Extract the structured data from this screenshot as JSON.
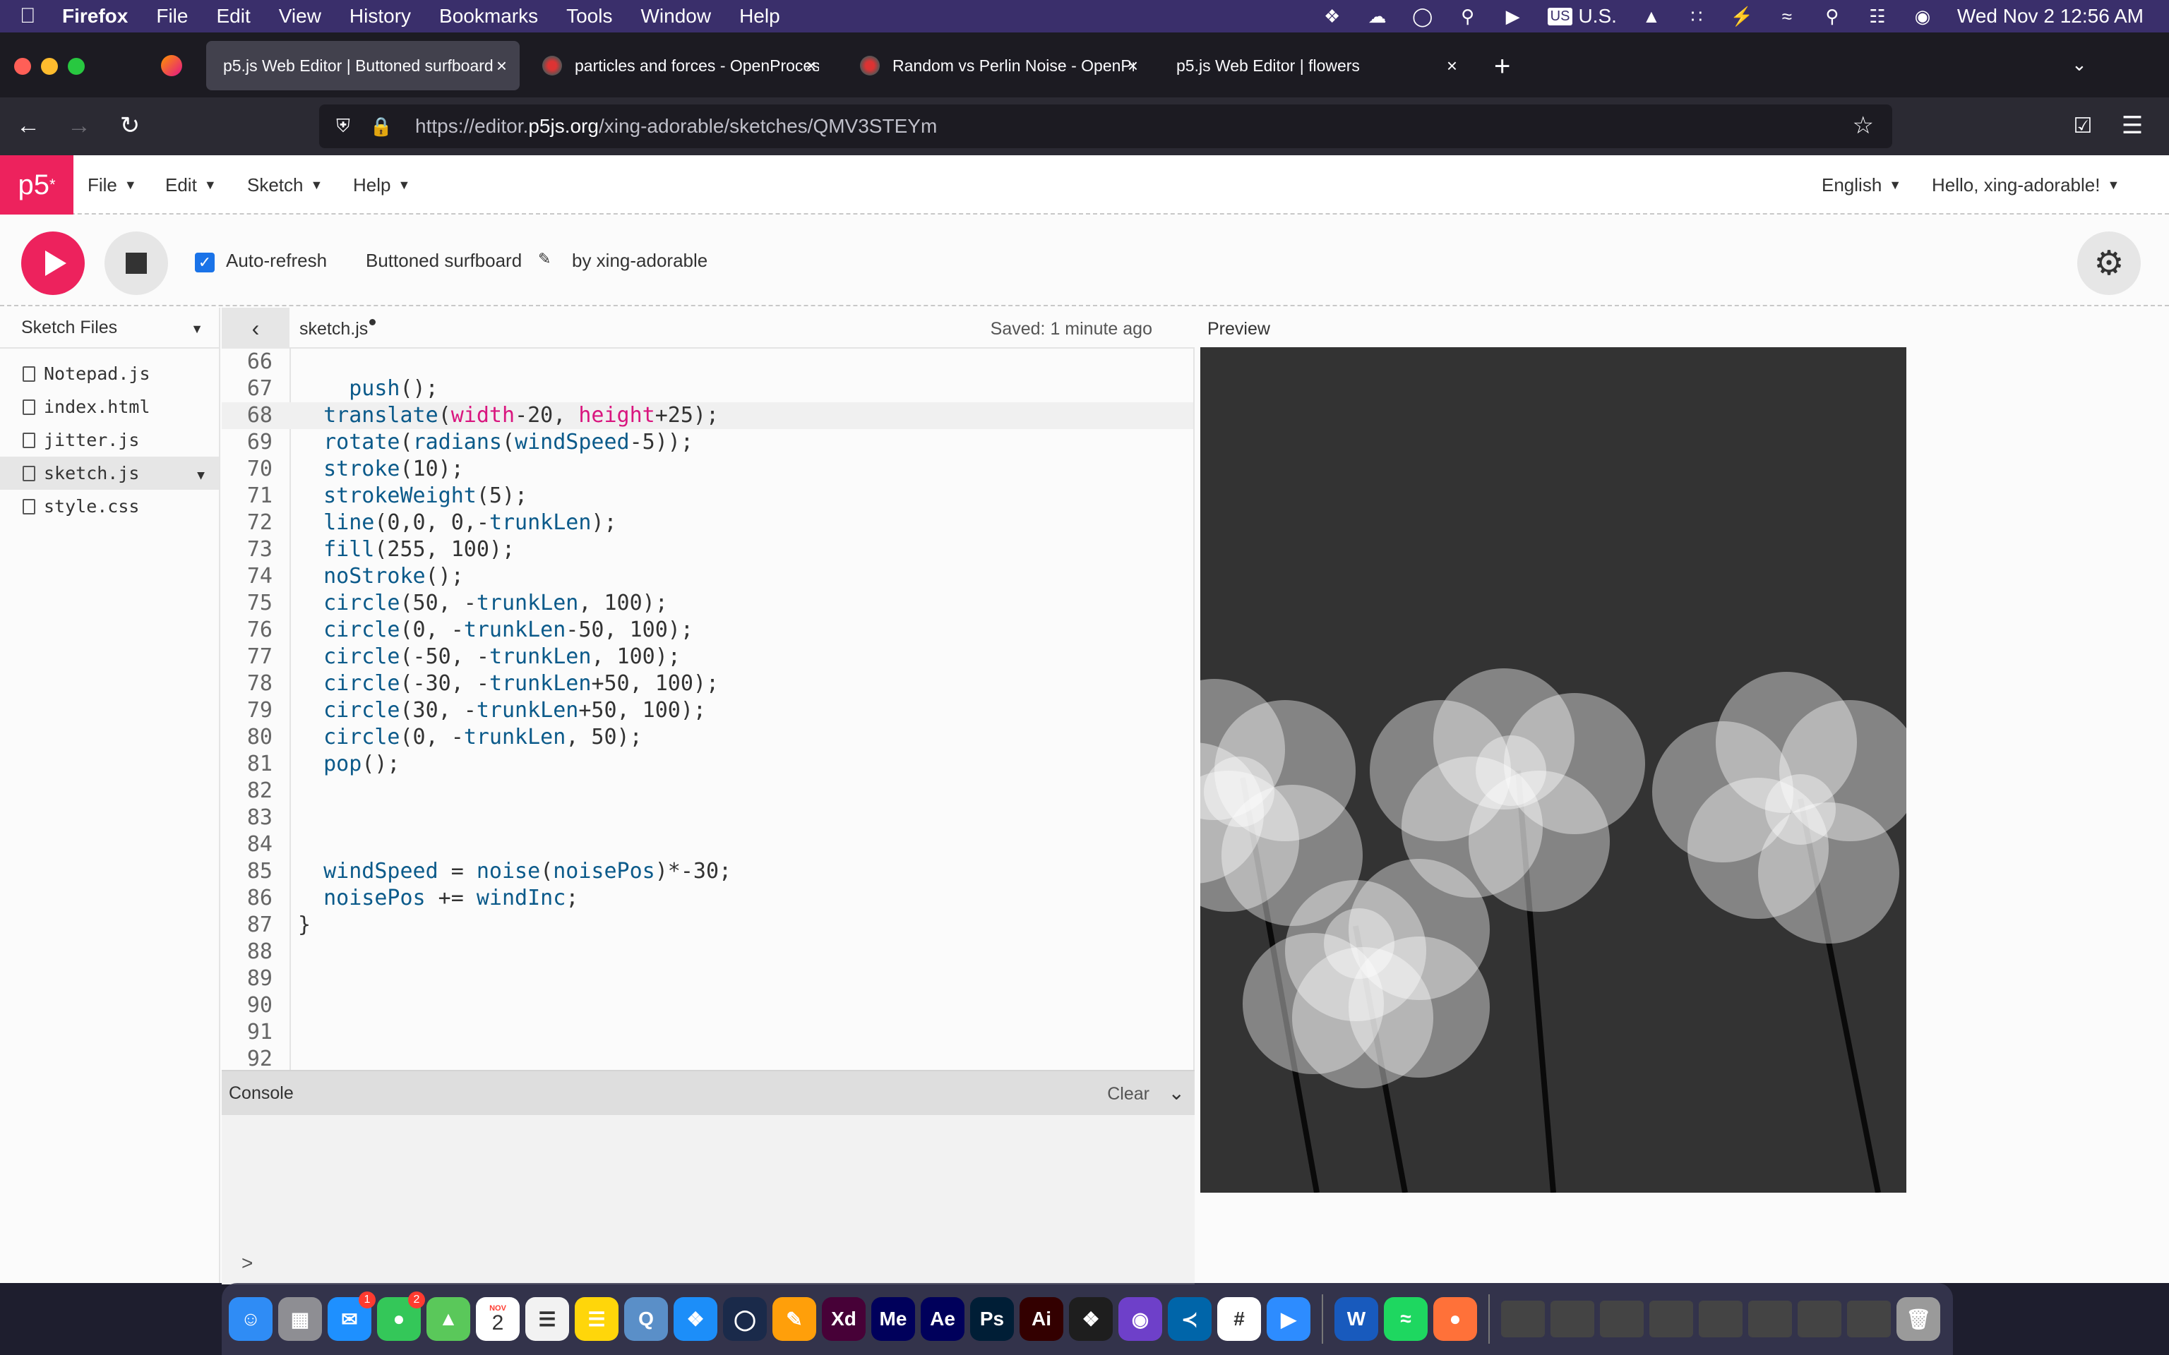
{
  "menubar": {
    "apple": "",
    "app": "Firefox",
    "items": [
      "File",
      "Edit",
      "View",
      "History",
      "Bookmarks",
      "Tools",
      "Window",
      "Help"
    ],
    "input_source": "U.S.",
    "clock": "Wed Nov 2  12:56 AM"
  },
  "tabs": [
    {
      "title": "p5.js Web Editor | Buttoned surfboard",
      "active": true
    },
    {
      "title": "particles and forces - OpenProcessing",
      "active": false
    },
    {
      "title": "Random vs Perlin Noise - OpenProcessing",
      "active": false
    },
    {
      "title": "p5.js Web Editor | flowers",
      "active": false
    }
  ],
  "urlbar": {
    "prefix": "https://editor.",
    "domain": "p5js.org",
    "path": "/xing-adorable/sketches/QMV3STEYm"
  },
  "p5": {
    "logo": "p5",
    "menu": [
      "File",
      "Edit",
      "Sketch",
      "Help"
    ],
    "language": "English",
    "user": "Hello, xing-adorable!",
    "auto_refresh": "Auto-refresh",
    "sketch_name": "Buttoned surfboard",
    "author": "by xing-adorable"
  },
  "sidebar": {
    "title": "Sketch Files",
    "files": [
      "Notepad.js",
      "index.html",
      "jitter.js",
      "sketch.js",
      "style.css"
    ],
    "selected": "sketch.js"
  },
  "editor": {
    "filename": "sketch.js",
    "saved": "Saved: 1 minute ago",
    "current_line": 68,
    "lines": [
      {
        "n": "66",
        "t": ""
      },
      {
        "n": "67",
        "t": "    push();"
      },
      {
        "n": "68",
        "t": "  translate(width-20, height+25);"
      },
      {
        "n": "69",
        "t": "  rotate(radians(windSpeed-5));"
      },
      {
        "n": "70",
        "t": "  stroke(10);"
      },
      {
        "n": "71",
        "t": "  strokeWeight(5);"
      },
      {
        "n": "72",
        "t": "  line(0,0, 0,-trunkLen);"
      },
      {
        "n": "73",
        "t": "  fill(255, 100);"
      },
      {
        "n": "74",
        "t": "  noStroke();"
      },
      {
        "n": "75",
        "t": "  circle(50, -trunkLen, 100);"
      },
      {
        "n": "76",
        "t": "  circle(0, -trunkLen-50, 100);"
      },
      {
        "n": "77",
        "t": "  circle(-50, -trunkLen, 100);"
      },
      {
        "n": "78",
        "t": "  circle(-30, -trunkLen+50, 100);"
      },
      {
        "n": "79",
        "t": "  circle(30, -trunkLen+50, 100);"
      },
      {
        "n": "80",
        "t": "  circle(0, -trunkLen, 50);"
      },
      {
        "n": "81",
        "t": "  pop();"
      },
      {
        "n": "82",
        "t": ""
      },
      {
        "n": "83",
        "t": ""
      },
      {
        "n": "84",
        "t": ""
      },
      {
        "n": "85",
        "t": "  windSpeed = noise(noisePos)*-30;"
      },
      {
        "n": "86",
        "t": "  noisePos += windInc;"
      },
      {
        "n": "87",
        "t": "}"
      },
      {
        "n": "88",
        "t": ""
      },
      {
        "n": "89",
        "t": ""
      },
      {
        "n": "90",
        "t": ""
      },
      {
        "n": "91",
        "t": ""
      },
      {
        "n": "92",
        "t": ""
      }
    ]
  },
  "preview": {
    "title": "Preview",
    "bg": "#333333"
  },
  "console": {
    "title": "Console",
    "clear": "Clear",
    "prompt": ">"
  },
  "colors": {
    "p5_pink": "#ed225d",
    "keyword": "#0b5a8a",
    "variable": "#d9167f",
    "menubar": "#3a2f6b"
  },
  "dock": {
    "apps": [
      "Finder",
      "Launchpad",
      "Mail",
      "Messages",
      "Maps",
      "Calendar",
      "Reminders",
      "Notes",
      "QuickTime",
      "Safari",
      "Cinema 4D",
      "Pages",
      "Xd",
      "Me",
      "Ae",
      "Ps",
      "Ai",
      "Figma",
      "GitHub",
      "VS Code",
      "Slack",
      "Zoom",
      "Word",
      "Spotify",
      "Firefox"
    ],
    "badges": {
      "Mail": "1",
      "Messages": "2"
    },
    "calendar_day": "2",
    "calendar_month": "NOV"
  }
}
